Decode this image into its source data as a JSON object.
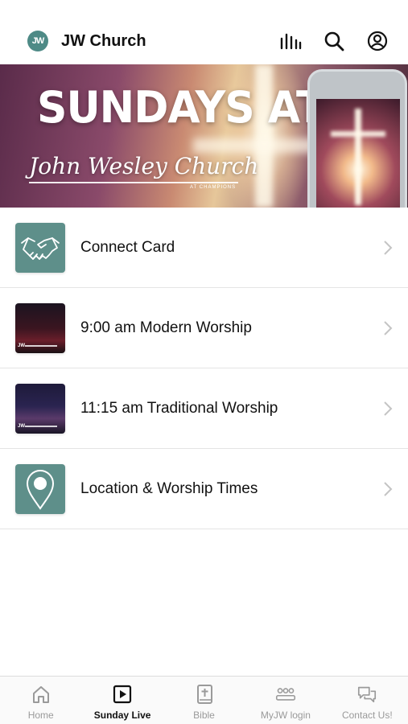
{
  "header": {
    "logo_text": "JW",
    "title": "JW Church",
    "icons": [
      "audio-bars-icon",
      "search-icon",
      "account-icon"
    ]
  },
  "banner": {
    "headline": "SUNDAYS AT",
    "script_text": "John Wesley Church",
    "subtext": "AT CHAMPIONS"
  },
  "menu": {
    "items": [
      {
        "label": "Connect Card",
        "thumb": "handshake-icon"
      },
      {
        "label": "9:00 am Modern Worship",
        "thumb": "modern-worship-thumbnail"
      },
      {
        "label": "11:15 am Traditional Worship",
        "thumb": "traditional-worship-thumbnail"
      },
      {
        "label": "Location & Worship Times",
        "thumb": "map-pin-icon"
      }
    ]
  },
  "tabs": [
    {
      "label": "Home",
      "icon": "home-icon",
      "active": false
    },
    {
      "label": "Sunday Live",
      "icon": "play-icon",
      "active": true
    },
    {
      "label": "Bible",
      "icon": "bible-icon",
      "active": false
    },
    {
      "label": "MyJW login",
      "icon": "group-icon",
      "active": false
    },
    {
      "label": "Contact Us!",
      "icon": "chat-icon",
      "active": false
    }
  ],
  "colors": {
    "accent_teal": "#5e8f8a",
    "tab_inactive": "#9a9a9a",
    "tab_active": "#111111"
  }
}
